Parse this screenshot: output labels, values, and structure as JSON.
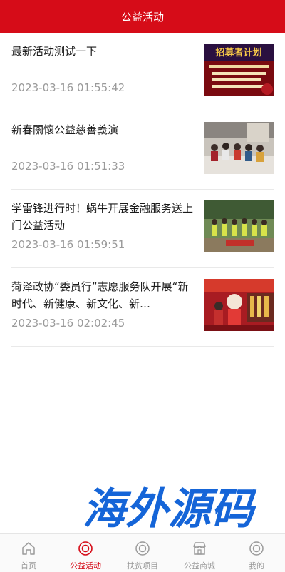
{
  "header": {
    "title": "公益活动"
  },
  "articles": [
    {
      "title": "最新活动测试一下",
      "time": "2023-03-16 01:55:42"
    },
    {
      "title": "新春關懷公益慈善義演",
      "time": "2023-03-16 01:51:33"
    },
    {
      "title": "学雷锋进行时！蜗牛开展金融服务送上门公益活动",
      "time": "2023-03-16 01:59:51"
    },
    {
      "title": "菏泽政协“委员行”志愿服务队开展“新时代、新健康、新文化、新…",
      "time": "2023-03-16 02:02:45"
    }
  ],
  "thumb1_banner": "招募者计划",
  "watermark": "海外源码",
  "tabbar": {
    "items": [
      {
        "label": "首页",
        "icon": "home-icon"
      },
      {
        "label": "公益活动",
        "icon": "target-icon",
        "active": true
      },
      {
        "label": "扶贫项目",
        "icon": "target-icon"
      },
      {
        "label": "公益商城",
        "icon": "store-icon"
      },
      {
        "label": "我的",
        "icon": "target-icon"
      }
    ]
  },
  "colors": {
    "brand": "#d60c18",
    "muted": "#9a9a9a",
    "watermark": "#1565d8"
  }
}
